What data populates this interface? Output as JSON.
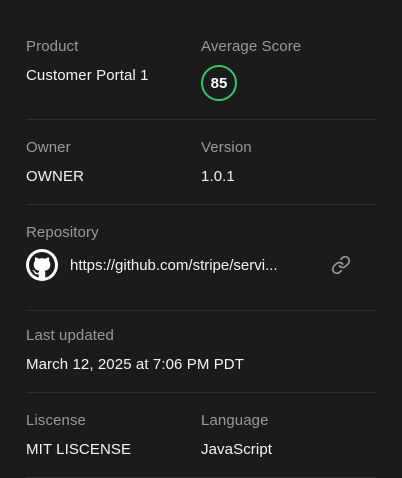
{
  "product": {
    "label": "Product",
    "value": "Customer Portal 1"
  },
  "average_score": {
    "label": "Average Score",
    "value": "85",
    "color": "#34c76a"
  },
  "owner": {
    "label": "Owner",
    "value": "OWNER"
  },
  "version": {
    "label": "Version",
    "value": "1.0.1"
  },
  "repository": {
    "label": "Repository",
    "url_display": "https://github.com/stripe/servi...",
    "icon": "github-icon",
    "action_icon": "link-icon"
  },
  "last_updated": {
    "label": "Last updated",
    "value": "March 12, 2025 at 7:06 PM PDT"
  },
  "license": {
    "label": "Liscense",
    "value": "MIT LISCENSE"
  },
  "language": {
    "label": "Language",
    "value": "JavaScript"
  }
}
